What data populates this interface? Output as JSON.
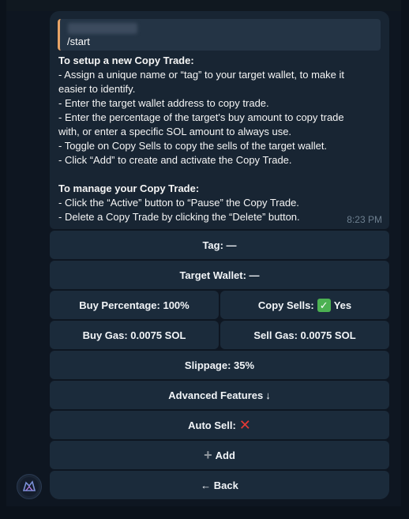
{
  "message": {
    "reply_text": "/start",
    "heading_setup": "To setup a new Copy Trade:",
    "setup_lines": [
      "- Assign a unique name or “tag” to your target wallet, to make it",
      "easier to identify.",
      "- Enter the target wallet address to copy trade.",
      "- Enter the percentage of the target's buy amount to copy trade",
      "with, or enter a specific SOL amount to always use.",
      "- Toggle on Copy Sells to copy the sells of the target wallet.",
      "- Click “Add” to create and activate the Copy Trade."
    ],
    "heading_manage": "To manage your Copy Trade:",
    "manage_lines": [
      "- Click the “Active” button to “Pause” the Copy Trade.",
      "- Delete a Copy Trade by clicking the “Delete” button."
    ],
    "time": "8:23 PM"
  },
  "keyboard": {
    "tag": "Tag: —",
    "target_wallet": "Target Wallet: —",
    "buy_percentage": "Buy Percentage: 100%",
    "copy_sells_label": "Copy Sells:",
    "copy_sells_value": "Yes",
    "buy_gas": "Buy Gas: 0.0075 SOL",
    "sell_gas": "Sell Gas: 0.0075 SOL",
    "slippage": "Slippage: 35%",
    "advanced": "Advanced Features",
    "advanced_arrow": "↓",
    "auto_sell_label": "Auto Sell:",
    "auto_sell_icon": "❌",
    "add_icon": "➕",
    "add": "Add",
    "back": "← Back"
  },
  "colors": {
    "background": "#0e1621",
    "bubble": "#182533",
    "button": "#1b2b3b",
    "reply_accent": "#e8a467",
    "check_green": "#4cb152",
    "cross_red": "#e53935"
  },
  "icons": {
    "avatar": "bot-avatar-icon",
    "copy_sells": "checkmark-icon",
    "auto_sell": "cross-icon",
    "add": "plus-icon",
    "advanced": "arrow-down-icon"
  }
}
